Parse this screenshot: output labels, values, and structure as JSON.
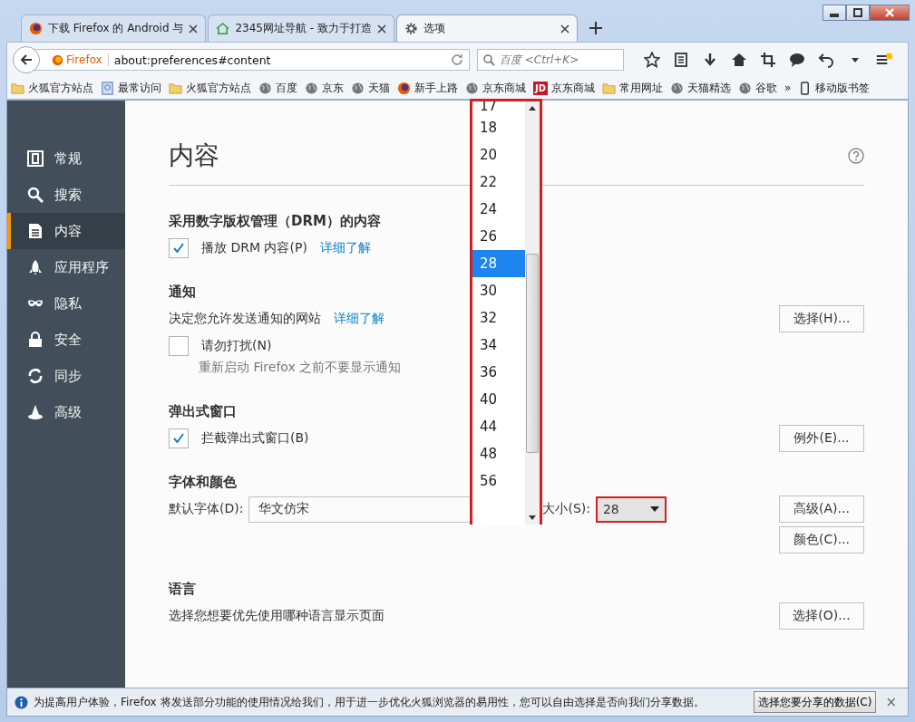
{
  "tabs": [
    {
      "title": "下载 Firefox 的 Android 与",
      "kind": "firefox",
      "selected": false
    },
    {
      "title": "2345网址导航 - 致力于打造",
      "kind": "house",
      "selected": false
    },
    {
      "title": "选项",
      "kind": "gear",
      "selected": true
    }
  ],
  "nav": {
    "identity": "Firefox",
    "url": "about:preferences#content",
    "search_placeholder": "百度 <Ctrl+K>"
  },
  "bookmarks": [
    {
      "label": "火狐官方站点",
      "kind": "folder"
    },
    {
      "label": "最常访问",
      "kind": "page"
    },
    {
      "label": "火狐官方站点",
      "kind": "folder"
    },
    {
      "label": "百度",
      "kind": "globe"
    },
    {
      "label": "京东",
      "kind": "globe"
    },
    {
      "label": "天猫",
      "kind": "globe"
    },
    {
      "label": "新手上路",
      "kind": "firefox"
    },
    {
      "label": "京东商城",
      "kind": "globe"
    },
    {
      "label": "京东商城",
      "kind": "jd",
      "icon_text": "JD"
    },
    {
      "label": "常用网址",
      "kind": "folder"
    },
    {
      "label": "天猫精选",
      "kind": "globe"
    },
    {
      "label": "谷歌",
      "kind": "globe"
    }
  ],
  "bookmarks_overflow": "»",
  "mobile_bookmarks": "移动版书签",
  "sidebar": {
    "items": [
      {
        "label": "常规",
        "kind": "general",
        "selected": false
      },
      {
        "label": "搜索",
        "kind": "search",
        "selected": false
      },
      {
        "label": "内容",
        "kind": "content",
        "selected": true
      },
      {
        "label": "应用程序",
        "kind": "rocket",
        "selected": false
      },
      {
        "label": "隐私",
        "kind": "mask",
        "selected": false
      },
      {
        "label": "安全",
        "kind": "lock",
        "selected": false
      },
      {
        "label": "同步",
        "kind": "sync",
        "selected": false
      },
      {
        "label": "高级",
        "kind": "wizard",
        "selected": false
      }
    ]
  },
  "page": {
    "title": "内容",
    "drm": {
      "heading": "采用数字版权管理（DRM）的内容",
      "checkbox": {
        "label": "播放 DRM 内容(P)",
        "checked": true
      },
      "link": "详细了解"
    },
    "notifications": {
      "heading": "通知",
      "text": "决定您允许发送通知的网站",
      "link": "详细了解",
      "button": "选择(H)...",
      "checkbox": {
        "label": "请勿打扰(N)",
        "checked": false
      },
      "hint": "重新启动 Firefox 之前不要显示通知"
    },
    "popups": {
      "heading": "弹出式窗口",
      "checkbox": {
        "label": "拦截弹出式窗口(B)",
        "checked": true
      },
      "button": "例外(E)..."
    },
    "fonts": {
      "heading": "字体和颜色",
      "font_label": "默认字体(D):",
      "font_value": "华文仿宋",
      "size_label": "大小(S):",
      "size_value": "28",
      "buttons": [
        "高级(A)...",
        "颜色(C)..."
      ]
    },
    "language": {
      "heading": "语言",
      "text": "选择您想要优先使用哪种语言显示页面",
      "button": "选择(O)..."
    }
  },
  "size_dropdown": {
    "options": [
      {
        "label": "17",
        "selected": false
      },
      {
        "label": "18",
        "selected": false
      },
      {
        "label": "20",
        "selected": false
      },
      {
        "label": "22",
        "selected": false
      },
      {
        "label": "24",
        "selected": false
      },
      {
        "label": "26",
        "selected": false
      },
      {
        "label": "28",
        "selected": true
      },
      {
        "label": "30",
        "selected": false
      },
      {
        "label": "32",
        "selected": false
      },
      {
        "label": "34",
        "selected": false
      },
      {
        "label": "36",
        "selected": false
      },
      {
        "label": "40",
        "selected": false
      },
      {
        "label": "44",
        "selected": false
      },
      {
        "label": "48",
        "selected": false
      },
      {
        "label": "56",
        "selected": false
      }
    ]
  },
  "info_bar": {
    "text": "为提高用户体验，Firefox 将发送部分功能的使用情况给我们，用于进一步优化火狐浏览器的易用性，您可以自由选择是否向我们分享数据。",
    "button": "选择您要分享的数据(C)",
    "close": "×"
  }
}
